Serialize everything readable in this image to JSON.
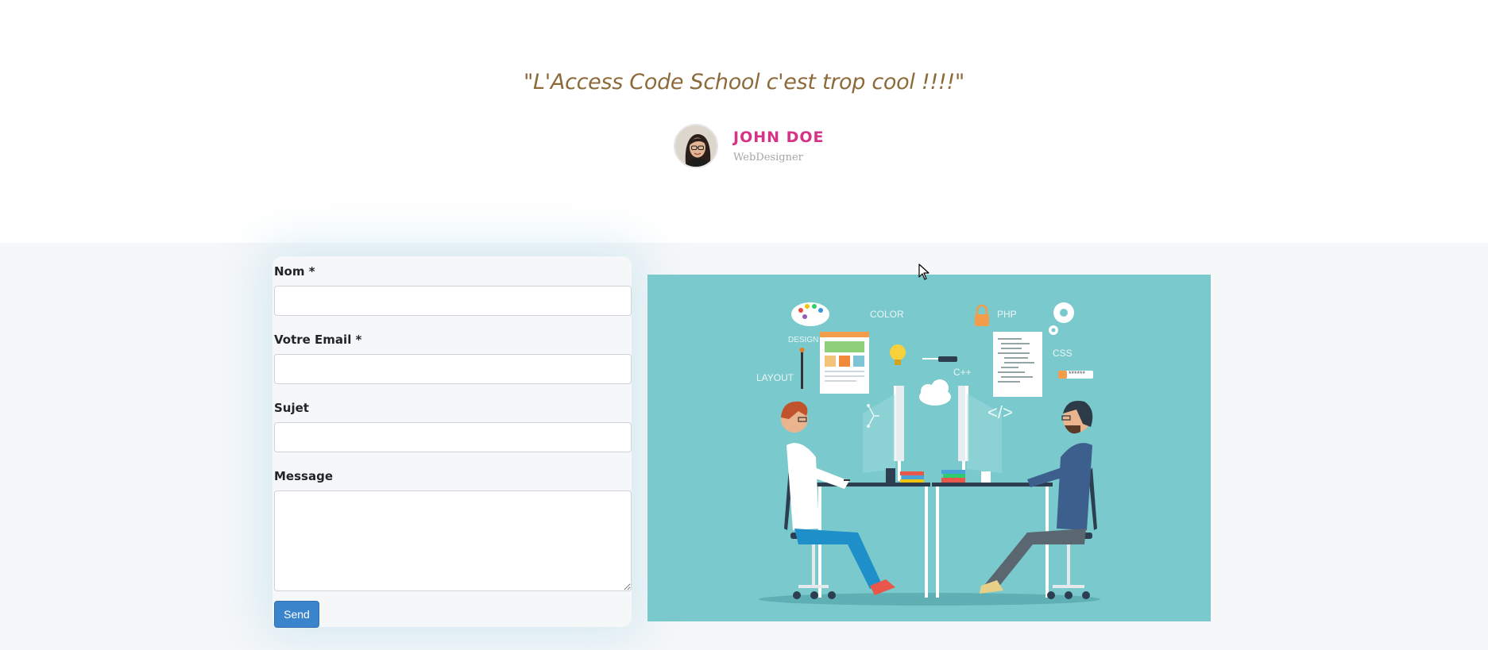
{
  "testimonial": {
    "quote": "\"L'Access Code School c'est trop cool !!!!\"",
    "author_name": "JOHN DOE",
    "author_role": "WebDesigner"
  },
  "contact_form": {
    "name_label": "Nom *",
    "name_value": "",
    "email_label": "Votre Email *",
    "email_value": "",
    "subject_label": "Sujet",
    "subject_value": "",
    "message_label": "Message",
    "message_value": "",
    "send_label": "Send"
  },
  "illustration": {
    "labels": {
      "color": "COLOR",
      "design": "DESIGN",
      "layout": "LAYOUT",
      "php": "PHP",
      "css": "CSS",
      "cpp": "C++",
      "code_tag": "</>",
      "password": "******"
    }
  },
  "colors": {
    "quote": "#8d6a3a",
    "author_name": "#d63384",
    "send_button": "#3a84cc",
    "illustration_bg": "#79c9cd"
  }
}
